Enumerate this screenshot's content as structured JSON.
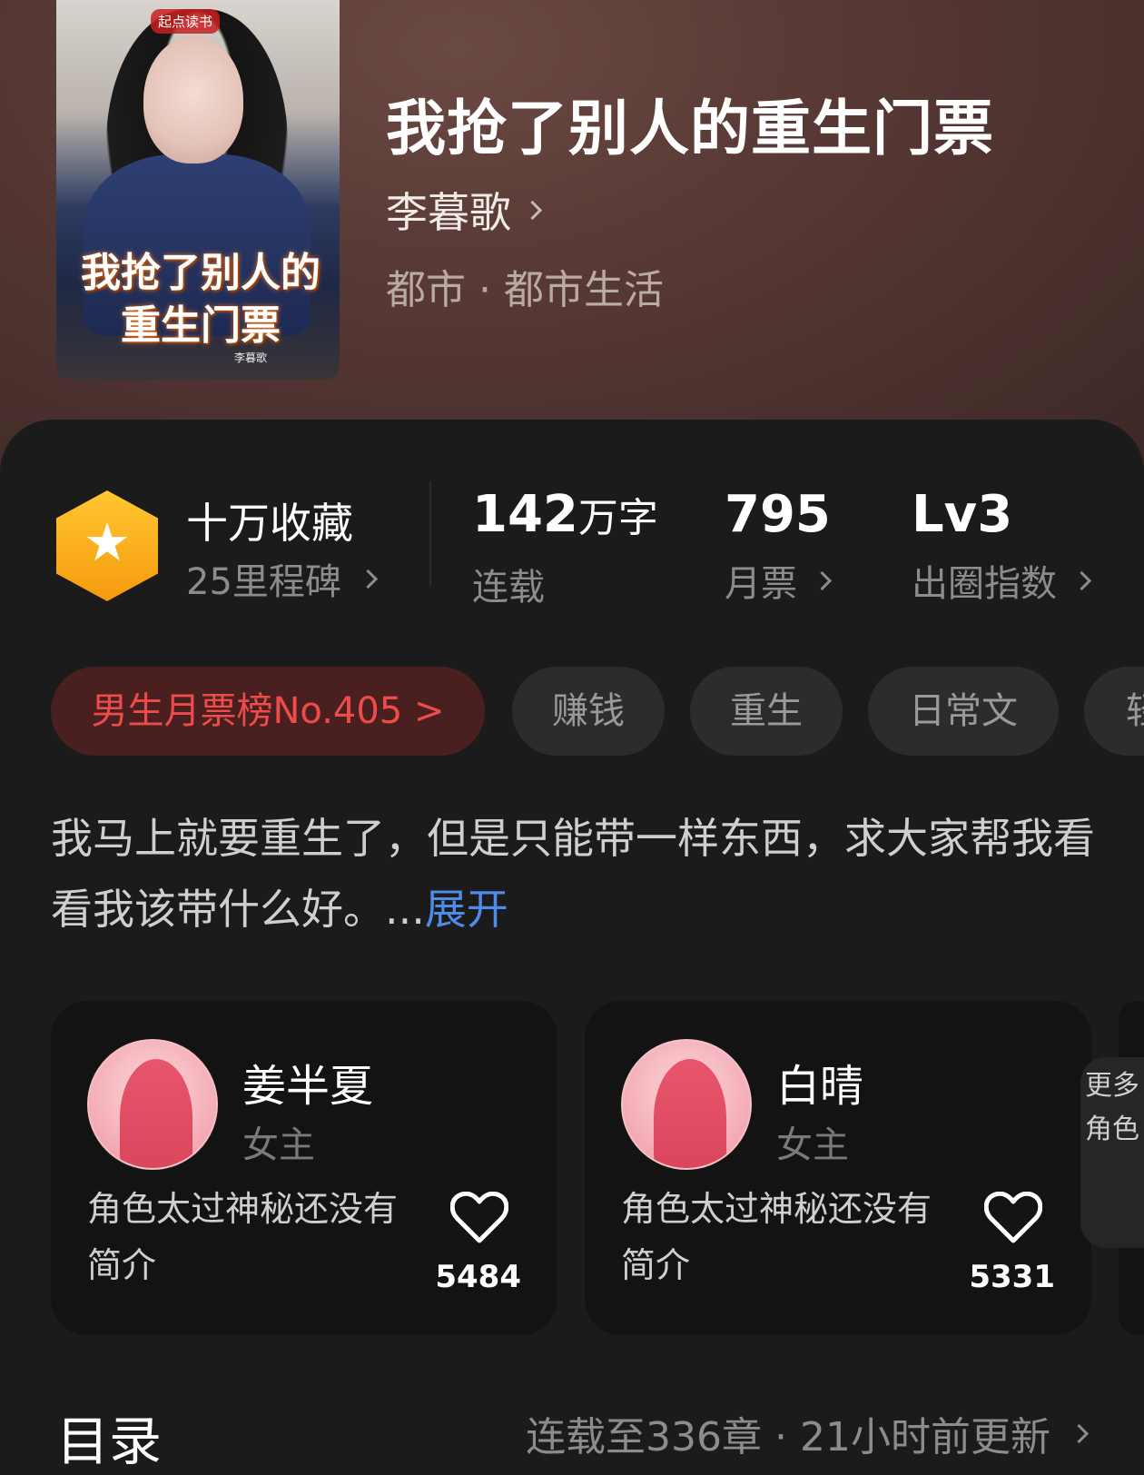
{
  "book": {
    "title": "我抢了别人的重生门票",
    "author": "李暮歌",
    "category": "都市 · 都市生活",
    "cover": {
      "publisher_logo": "起点读书",
      "title_line1": "我抢了别人的",
      "title_line2": "重生门票",
      "author": "李暮歌"
    }
  },
  "stats": {
    "collect_title": "十万收藏",
    "milestone": "25里程碑",
    "words_num": "142",
    "words_unit": "万字",
    "words_label": "连载",
    "monthly_num": "795",
    "monthly_label": "月票",
    "index_num": "Lv3",
    "index_label": "出圈指数"
  },
  "tags": [
    {
      "label": "男生月票榜No.405 >",
      "type": "rank"
    },
    {
      "label": "赚钱",
      "type": "tag"
    },
    {
      "label": "重生",
      "type": "tag"
    },
    {
      "label": "日常文",
      "type": "tag"
    },
    {
      "label": "轻",
      "type": "tag"
    }
  ],
  "synopsis": {
    "text": "我马上就要重生了，但是只能带一样东西，求大家帮我看看我该带什么好。...",
    "expand": "展开"
  },
  "characters": [
    {
      "name": "姜半夏",
      "role": "女主",
      "desc": "角色太过神秘还没有简介",
      "likes": "5484"
    },
    {
      "name": "白晴",
      "role": "女主",
      "desc": "角色太过神秘还没有简介",
      "likes": "5331"
    }
  ],
  "more_roles": "更多角色",
  "toc": {
    "title": "目录",
    "info": "连载至336章 · 21小时前更新"
  },
  "colors": {
    "accent_blue": "#4f8be8",
    "rank_red": "#ee4b4b",
    "badge_gold": "#f5a623"
  }
}
